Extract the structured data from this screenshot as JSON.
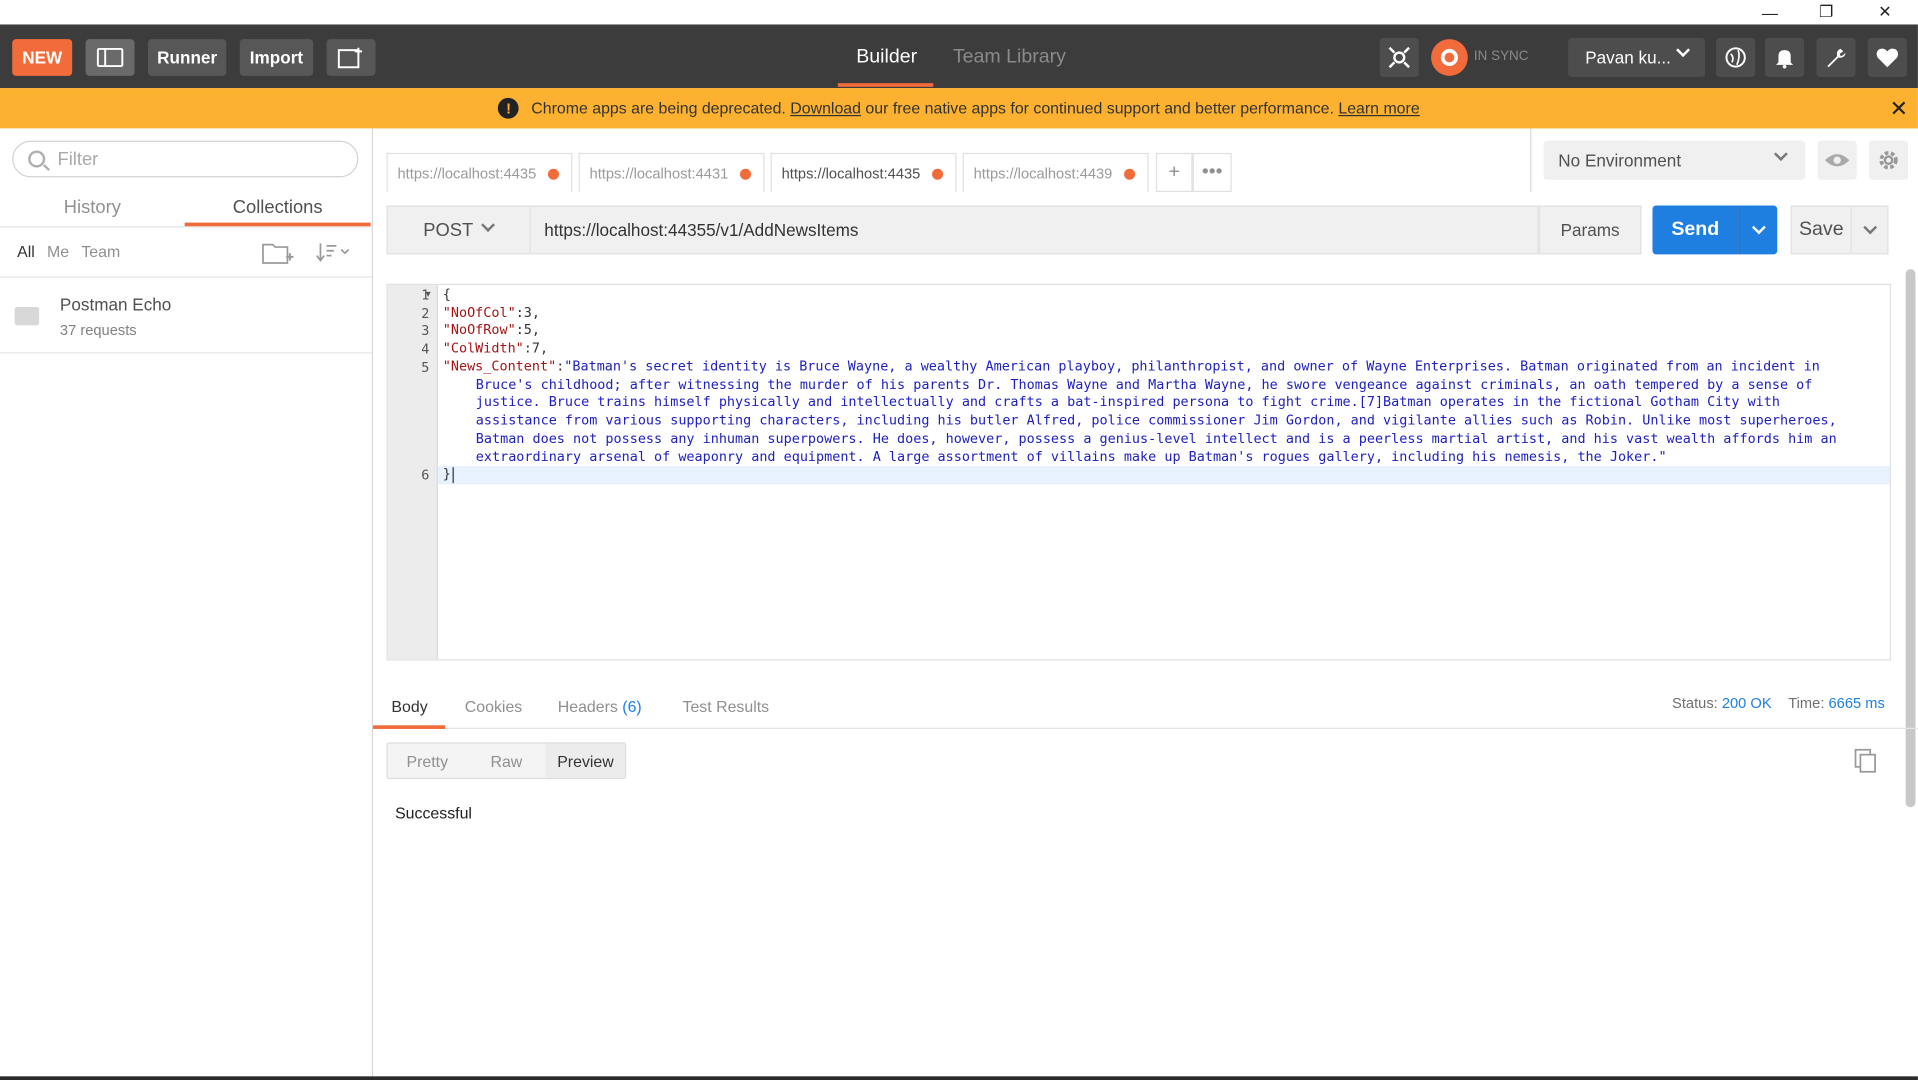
{
  "window": {
    "minimize_glyph": "—",
    "restore_glyph": "❐",
    "close_glyph": "✕"
  },
  "header": {
    "new_label": "NEW",
    "runner_label": "Runner",
    "import_label": "Import",
    "tabs": [
      {
        "label": "Builder",
        "active": true
      },
      {
        "label": "Team Library",
        "active": false
      }
    ],
    "sync_status": "IN SYNC",
    "user_name": "Pavan ku..."
  },
  "banner": {
    "text_before": "Chrome apps are being deprecated.",
    "download_link": "Download",
    "text_middle": "our free native apps for continued support and better performance.",
    "learn_more_link": "Learn more"
  },
  "sidebar": {
    "filter_placeholder": "Filter",
    "tabs": [
      {
        "label": "History",
        "active": false
      },
      {
        "label": "Collections",
        "active": true
      }
    ],
    "filters": [
      "All",
      "Me",
      "Team"
    ],
    "collections": [
      {
        "name": "Postman Echo",
        "count": "37 requests"
      }
    ]
  },
  "request_tabs": [
    {
      "label": "https://localhost:4435",
      "active": false
    },
    {
      "label": "https://localhost:4431",
      "active": false
    },
    {
      "label": "https://localhost:4435",
      "active": true
    },
    {
      "label": "https://localhost:4439",
      "active": false
    }
  ],
  "environment": {
    "selected": "No Environment"
  },
  "request": {
    "method": "POST",
    "url": "https://localhost:44355/v1/AddNewsItems",
    "params_label": "Params",
    "send_label": "Send",
    "save_label": "Save"
  },
  "editor": {
    "line_numbers": [
      "1",
      "2",
      "3",
      "4",
      "5",
      "6"
    ],
    "lines": [
      {
        "text": "{"
      },
      {
        "key": "\"NoOfCol\"",
        "rest": ":3,"
      },
      {
        "key": "\"NoOfRow\"",
        "rest": ":5,"
      },
      {
        "key": "\"ColWidth\"",
        "rest": ":7,"
      },
      {
        "key": "\"News_Content\"",
        "rest": ":"
      },
      {
        "text": "}"
      }
    ],
    "news_content_lines": [
      "\"Batman's secret identity is Bruce Wayne, a wealthy American playboy, philanthropist, and owner of Wayne Enterprises. Batman originated from an incident in",
      "Bruce's childhood; after witnessing the murder of his parents Dr. Thomas Wayne and Martha Wayne, he swore vengeance against criminals, an oath tempered by a sense of",
      "justice. Bruce trains himself physically and intellectually and crafts a bat-inspired persona to fight crime.[7]Batman operates in the fictional Gotham City with",
      "assistance from various supporting characters, including his butler Alfred, police commissioner Jim Gordon, and vigilante allies such as Robin. Unlike most superheroes,",
      "Batman does not possess any inhuman superpowers. He does, however, possess a genius-level intellect and is a peerless martial artist, and his vast wealth affords him an",
      "extraordinary arsenal of weaponry and equipment. A large assortment of villains make up Batman's rogues gallery, including his nemesis, the Joker.\""
    ]
  },
  "response": {
    "tabs": [
      {
        "label": "Body",
        "active": true
      },
      {
        "label": "Cookies",
        "active": false
      },
      {
        "label": "Headers",
        "active": false
      },
      {
        "label": "Test Results",
        "active": false
      }
    ],
    "headers_count": "(6)",
    "status_label": "Status:",
    "status_value": "200 OK",
    "time_label": "Time:",
    "time_value": "6665 ms",
    "view_modes": [
      {
        "label": "Pretty",
        "active": false
      },
      {
        "label": "Raw",
        "active": false
      },
      {
        "label": "Preview",
        "active": true
      }
    ],
    "body_text": "Successful"
  },
  "colors": {
    "accent": "#f26b3a",
    "send_blue": "#1e7fe0",
    "banner": "#fcb131",
    "header": "#3c3c3c"
  },
  "icons": [
    "layout-toggle-icon",
    "new-window-icon",
    "interceptor-icon",
    "sync-icon",
    "globe-icon",
    "bell-icon",
    "wrench-icon",
    "heart-icon",
    "warning-icon",
    "search-icon",
    "new-folder-icon",
    "sort-icon",
    "eye-icon",
    "gear-icon",
    "copy-icon"
  ]
}
